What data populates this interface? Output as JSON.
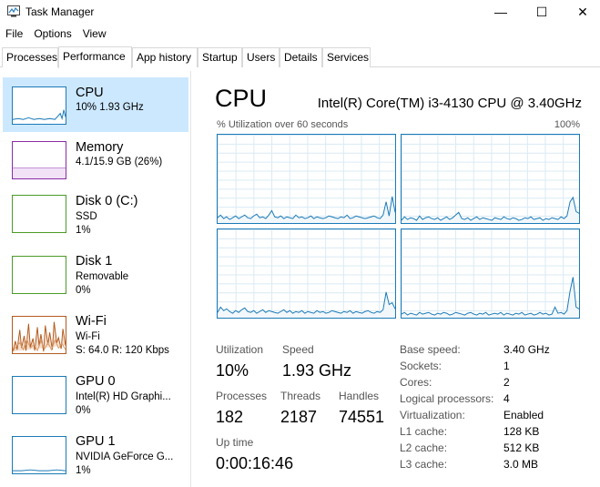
{
  "window": {
    "title": "Task Manager"
  },
  "window_controls": {
    "minimize": "—",
    "maximize": "☐",
    "close": "✕"
  },
  "menu": [
    "File",
    "Options",
    "View"
  ],
  "tabs": [
    "Processes",
    "Performance",
    "App history",
    "Startup",
    "Users",
    "Details",
    "Services"
  ],
  "sidebar": {
    "items": [
      {
        "title": "CPU",
        "lines": [
          "10% 1.93 GHz"
        ],
        "color": "#1c7ab7"
      },
      {
        "title": "Memory",
        "lines": [
          "4.1/15.9 GB (26%)"
        ],
        "color": "#8b2ca8"
      },
      {
        "title": "Disk 0 (C:)",
        "lines": [
          "SSD",
          "1%"
        ],
        "color": "#4b9b28"
      },
      {
        "title": "Disk 1",
        "lines": [
          "Removable",
          "0%"
        ],
        "color": "#4b9b28"
      },
      {
        "title": "Wi-Fi",
        "lines": [
          "Wi-Fi",
          "S: 64.0 R: 120 Kbps"
        ],
        "color": "#b35a1f"
      },
      {
        "title": "GPU 0",
        "lines": [
          "Intel(R) HD Graphi...",
          "0%"
        ],
        "color": "#1c7ab7"
      },
      {
        "title": "GPU 1",
        "lines": [
          "NVIDIA GeForce G...",
          "1%"
        ],
        "color": "#1c7ab7"
      }
    ]
  },
  "main": {
    "title": "CPU",
    "model": "Intel(R) Core(TM) i3-4130 CPU @ 3.40GHz",
    "axis_label": "% Utilization over 60 seconds",
    "axis_max": "100%",
    "stats": {
      "utilization_label": "Utilization",
      "utilization": "10%",
      "speed_label": "Speed",
      "speed": "1.93 GHz",
      "processes_label": "Processes",
      "processes": "182",
      "threads_label": "Threads",
      "threads": "2187",
      "handles_label": "Handles",
      "handles": "74551",
      "uptime_label": "Up time",
      "uptime": "0:00:16:46"
    },
    "specs": [
      {
        "label": "Base speed:",
        "value": "3.40 GHz"
      },
      {
        "label": "Sockets:",
        "value": "1"
      },
      {
        "label": "Cores:",
        "value": "2"
      },
      {
        "label": "Logical processors:",
        "value": "4"
      },
      {
        "label": "Virtualization:",
        "value": "Enabled"
      },
      {
        "label": "L1 cache:",
        "value": "128 KB"
      },
      {
        "label": "L2 cache:",
        "value": "512 KB"
      },
      {
        "label": "L3 cache:",
        "value": "3.0 MB"
      }
    ]
  },
  "chart_data": [
    {
      "type": "area",
      "ylim": [
        0,
        100
      ],
      "values": [
        6,
        9,
        5,
        7,
        4,
        6,
        8,
        5,
        7,
        9,
        6,
        5,
        8,
        10,
        6,
        7,
        5,
        9,
        14,
        7,
        6,
        8,
        5,
        7,
        6,
        5,
        9,
        6,
        7,
        5,
        6,
        8,
        5,
        7,
        6,
        5,
        6,
        8,
        7,
        6,
        5,
        7,
        6,
        9,
        5,
        6,
        8,
        7,
        6,
        5,
        6,
        7,
        8,
        6,
        5,
        9,
        24,
        8,
        30,
        12
      ]
    },
    {
      "type": "area",
      "ylim": [
        0,
        100
      ],
      "values": [
        3,
        7,
        4,
        6,
        5,
        3,
        8,
        4,
        6,
        7,
        5,
        4,
        6,
        3,
        5,
        7,
        4,
        6,
        9,
        12,
        5,
        4,
        6,
        3,
        5,
        7,
        4,
        6,
        5,
        4,
        3,
        6,
        5,
        4,
        7,
        5,
        4,
        6,
        5,
        3,
        4,
        6,
        5,
        7,
        4,
        5,
        6,
        3,
        5,
        4,
        6,
        5,
        4,
        7,
        5,
        8,
        24,
        29,
        13,
        11
      ]
    },
    {
      "type": "area",
      "ylim": [
        0,
        100
      ],
      "values": [
        6,
        12,
        8,
        10,
        7,
        5,
        8,
        6,
        9,
        11,
        7,
        6,
        8,
        5,
        7,
        9,
        6,
        8,
        7,
        6,
        5,
        7,
        9,
        6,
        8,
        5,
        7,
        6,
        8,
        5,
        7,
        6,
        5,
        8,
        6,
        7,
        5,
        6,
        8,
        7,
        6,
        5,
        7,
        6,
        8,
        5,
        7,
        6,
        5,
        7,
        8,
        6,
        5,
        7,
        6,
        9,
        29,
        15,
        17,
        10
      ]
    },
    {
      "type": "area",
      "ylim": [
        0,
        100
      ],
      "values": [
        4,
        6,
        3,
        5,
        4,
        3,
        6,
        4,
        5,
        6,
        4,
        3,
        5,
        4,
        6,
        5,
        3,
        4,
        6,
        5,
        4,
        3,
        5,
        6,
        4,
        3,
        5,
        4,
        6,
        3,
        4,
        5,
        4,
        6,
        3,
        5,
        4,
        3,
        5,
        4,
        6,
        3,
        4,
        5,
        3,
        4,
        6,
        4,
        5,
        3,
        4,
        12,
        5,
        6,
        4,
        8,
        30,
        46,
        12,
        10
      ]
    }
  ]
}
